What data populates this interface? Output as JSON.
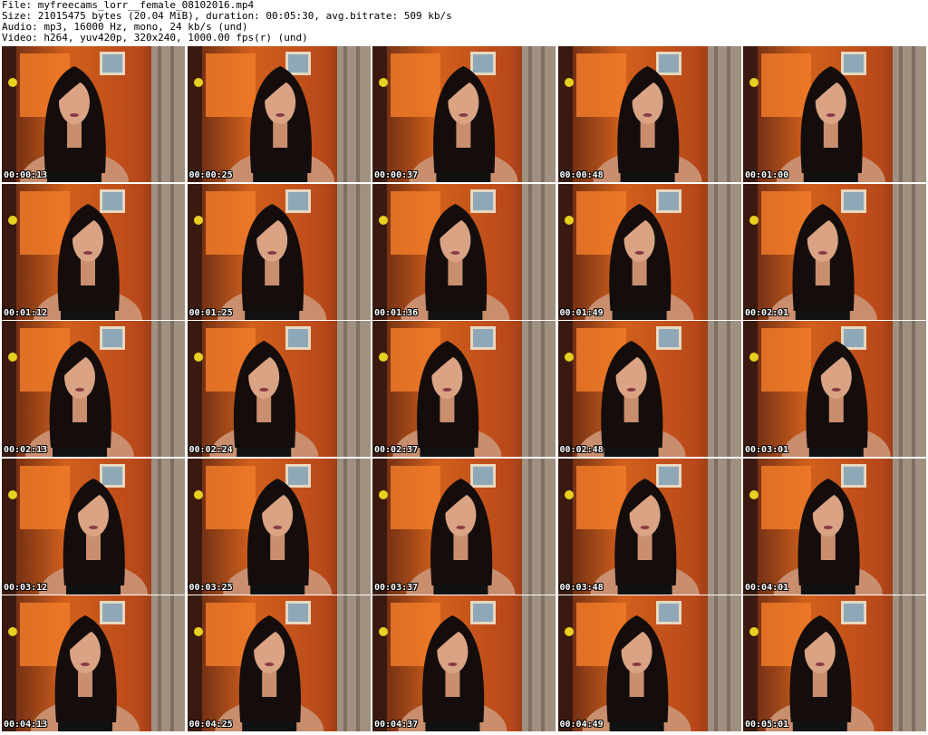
{
  "header": {
    "file": "File: myfreecams_lorr__female_08102016.mp4",
    "size": "Size: 21015475 bytes (20.04 MiB), duration: 00:05:30, avg.bitrate: 509 kb/s",
    "audio": "Audio: mp3, 16000 Hz, mono, 24 kb/s (und)",
    "video": "Video: h264, yuv420p, 320x240, 1000.00 fps(r) (und)"
  },
  "thumbnails": [
    {
      "timestamp": "00:00:13"
    },
    {
      "timestamp": "00:00:25"
    },
    {
      "timestamp": "00:00:37"
    },
    {
      "timestamp": "00:00:48"
    },
    {
      "timestamp": "00:01:00"
    },
    {
      "timestamp": "00:01:12"
    },
    {
      "timestamp": "00:01:25"
    },
    {
      "timestamp": "00:01:36"
    },
    {
      "timestamp": "00:01:49"
    },
    {
      "timestamp": "00:02:01"
    },
    {
      "timestamp": "00:02:13"
    },
    {
      "timestamp": "00:02:24"
    },
    {
      "timestamp": "00:02:37"
    },
    {
      "timestamp": "00:02:48"
    },
    {
      "timestamp": "00:03:01"
    },
    {
      "timestamp": "00:03:12"
    },
    {
      "timestamp": "00:03:25"
    },
    {
      "timestamp": "00:03:37"
    },
    {
      "timestamp": "00:03:48"
    },
    {
      "timestamp": "00:04:01"
    },
    {
      "timestamp": "00:04:13"
    },
    {
      "timestamp": "00:04:25"
    },
    {
      "timestamp": "00:04:37"
    },
    {
      "timestamp": "00:04:49"
    },
    {
      "timestamp": "00:05:01"
    }
  ],
  "colors": {
    "background": "#ffffff",
    "wall_orange": "#d2601c",
    "wall_dark": "#5a2412",
    "curtain": "#a09080",
    "hair": "#140d0c",
    "skin": "#c98e6e",
    "timestamp_text": "#ffffff"
  }
}
